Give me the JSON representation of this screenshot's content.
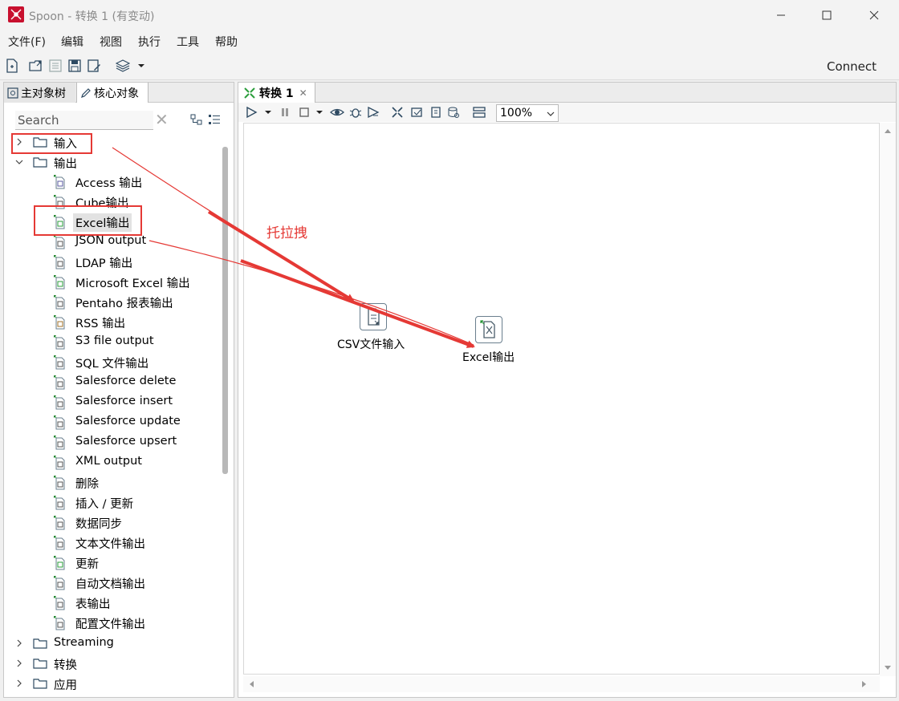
{
  "window": {
    "title": "Spoon - 转换 1 (有变动)"
  },
  "menu": [
    "文件(F)",
    "编辑",
    "视图",
    "执行",
    "工具",
    "帮助"
  ],
  "toolbar": {
    "connect_label": "Connect"
  },
  "left_panel": {
    "tabs": [
      "主对象树",
      "核心对象"
    ],
    "search_placeholder": "Search",
    "tree": {
      "input_folder": "输入",
      "output_folder": "输出",
      "output_items": [
        "Access 输出",
        "Cube输出",
        "Excel输出",
        "JSON output",
        "LDAP 输出",
        "Microsoft Excel 输出",
        "Pentaho 报表输出",
        "RSS 输出",
        "S3 file output",
        "SQL 文件输出",
        "Salesforce delete",
        "Salesforce insert",
        "Salesforce update",
        "Salesforce upsert",
        "XML output",
        "删除",
        "插入 / 更新",
        "数据同步",
        "文本文件输出",
        "更新",
        "自动文档输出",
        "表输出",
        "配置文件输出"
      ],
      "other_folders": [
        "Streaming",
        "转换",
        "应用"
      ]
    }
  },
  "right_panel": {
    "tab_label": "转换 1",
    "zoom_value": "100%",
    "nodes": [
      {
        "label": "CSV文件输入"
      },
      {
        "label": "Excel输出"
      }
    ],
    "annotation": "托拉拽"
  },
  "colors": {
    "annotation_red": "#e53935",
    "logo_red": "#c8102e"
  }
}
